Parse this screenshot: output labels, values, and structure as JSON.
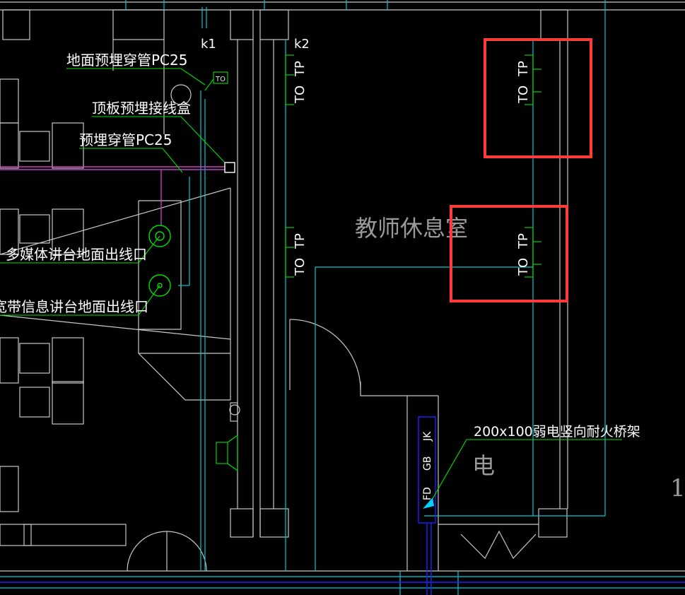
{
  "labels": {
    "floor_conduit": "地面预埋穿管PC25",
    "ceiling_box": "顶板预埋接线盒",
    "embedded_conduit": "预埋穿管PC25",
    "multimedia_outlet": "多媒体讲台地面出线口",
    "broadband_outlet": "宽带信息讲台地面出线口",
    "tray": "200x100弱电竖向耐火桥架",
    "room_name": "教师休息室",
    "partial_char": "电",
    "edge_char": "1"
  },
  "tags": {
    "k1": "k1",
    "k2": "k2",
    "to": "TO",
    "tp": "TP",
    "jk": "JK",
    "gb": "GB",
    "fd": "FD"
  },
  "colors": {
    "background": "#000000",
    "wall": "#c8c8c8",
    "cyan": "#00c8d8",
    "green": "#00e000",
    "magenta": "#c040c0",
    "blue": "#2020ff",
    "highlight": "#ff3b3b"
  }
}
